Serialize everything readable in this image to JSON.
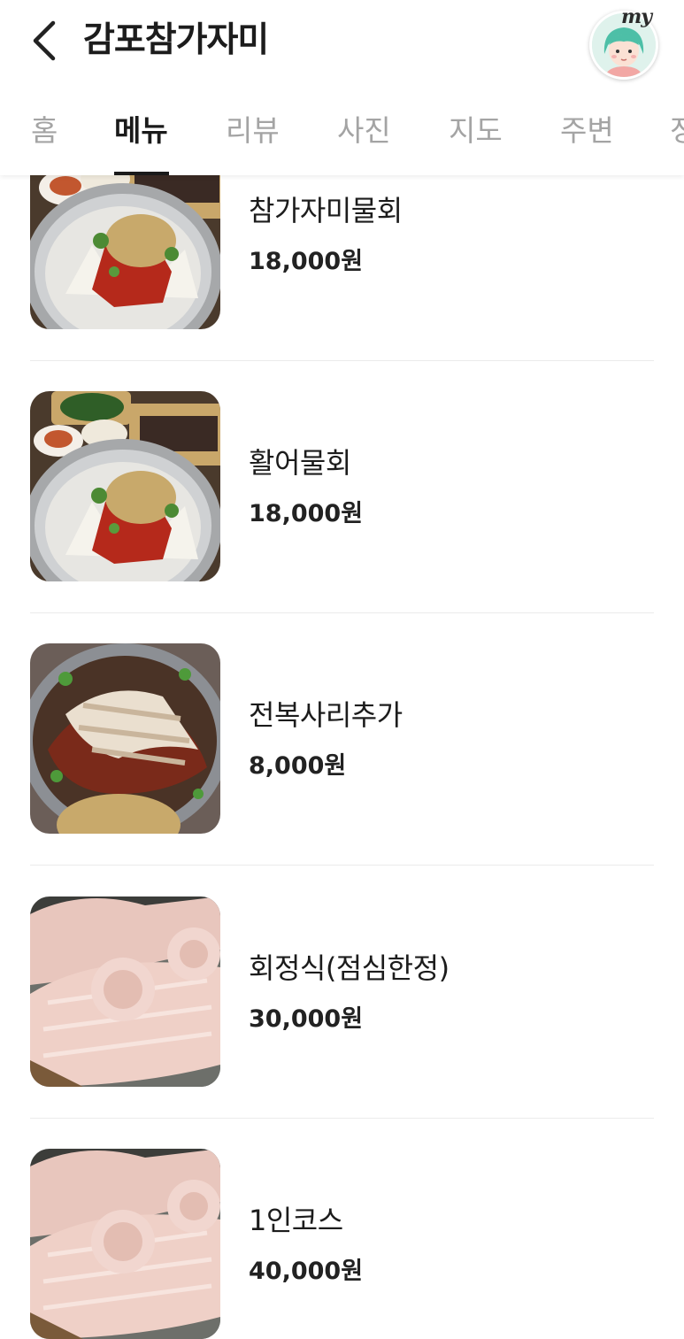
{
  "header": {
    "title": "감포참가자미",
    "my_label": "my"
  },
  "tabs": [
    {
      "label": "홈",
      "active": false
    },
    {
      "label": "메뉴",
      "active": true
    },
    {
      "label": "리뷰",
      "active": false
    },
    {
      "label": "사진",
      "active": false
    },
    {
      "label": "지도",
      "active": false
    },
    {
      "label": "주변",
      "active": false
    },
    {
      "label": "정",
      "active": false
    }
  ],
  "menu": [
    {
      "name": "참가자미물회",
      "price": "18,000원",
      "image": "mulhoe-bowl"
    },
    {
      "name": "활어물회",
      "price": "18,000원",
      "image": "mulhoe-bowl"
    },
    {
      "name": "전복사리추가",
      "price": "8,000원",
      "image": "abalone-platter"
    },
    {
      "name": "회정식(점심한정)",
      "price": "30,000원",
      "image": "sashimi-rolls"
    },
    {
      "name": "1인코스",
      "price": "40,000원",
      "image": "sashimi-rolls"
    }
  ],
  "colors": {
    "text_primary": "#1a1a1a",
    "tab_inactive": "#a4a4a4",
    "divider": "#ebebeb",
    "avatar_bg": "#dff2ec"
  }
}
